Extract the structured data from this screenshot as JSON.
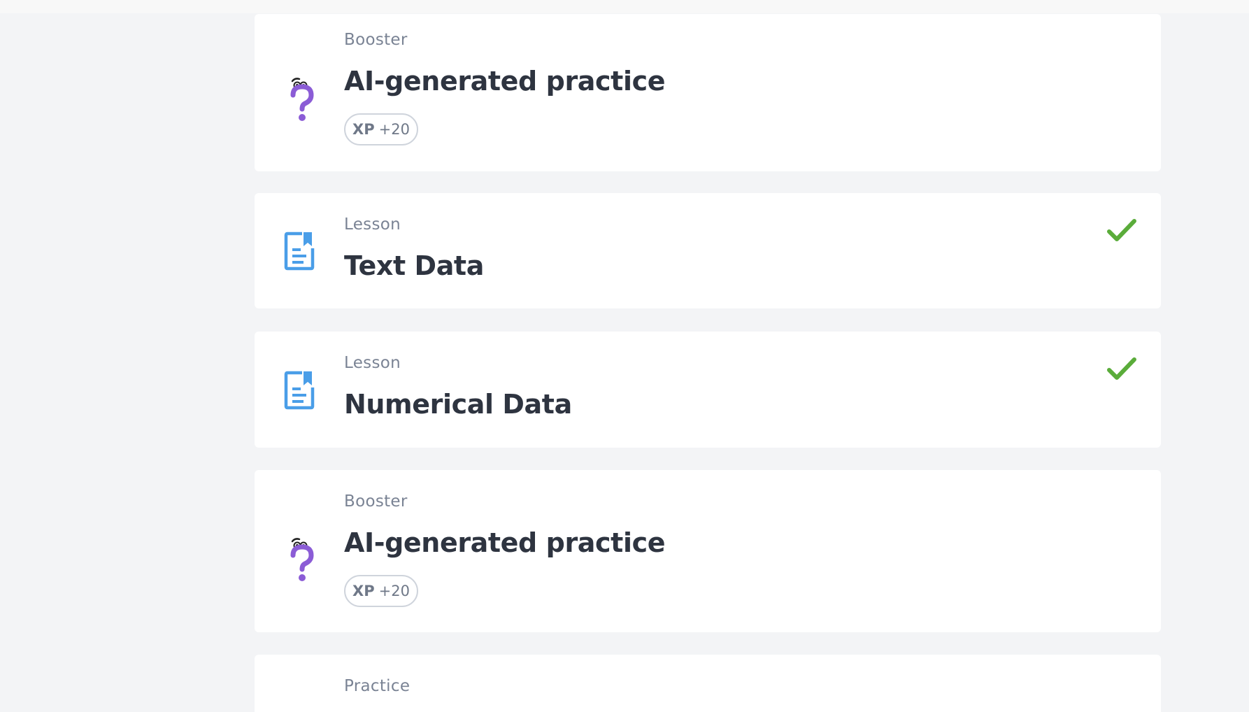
{
  "items": [
    {
      "type": "Booster",
      "title": "AI-generated practice",
      "xp_label": "XP",
      "xp_value": "+20",
      "icon": "question-mascot-icon"
    },
    {
      "type": "Lesson",
      "title": "Text Data",
      "icon": "lesson-document-icon",
      "completed": true
    },
    {
      "type": "Lesson",
      "title": "Numerical Data",
      "icon": "lesson-document-icon",
      "completed": true
    },
    {
      "type": "Booster",
      "title": "AI-generated practice",
      "xp_label": "XP",
      "xp_value": "+20",
      "icon": "question-mascot-icon"
    },
    {
      "type": "Practice"
    }
  ],
  "colors": {
    "background": "#f3f4f6",
    "card": "#ffffff",
    "title": "#2e3440",
    "type_label": "#7a8394",
    "check": "#5aac3a",
    "lesson_icon": "#4a9ee8",
    "booster_icon": "#8b5cd6"
  }
}
